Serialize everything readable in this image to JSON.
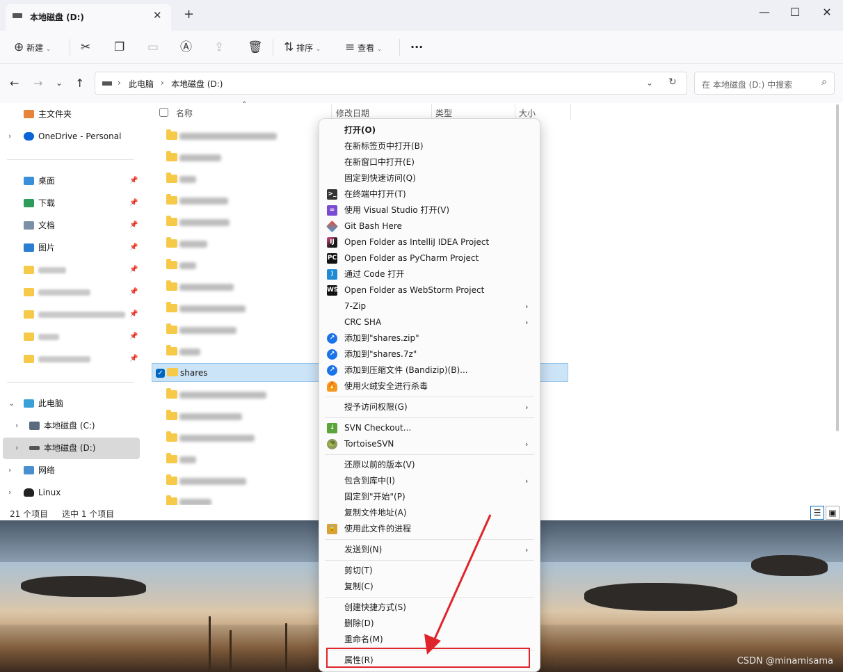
{
  "window": {
    "tab_title": "本地磁盘 (D:)",
    "minimize": "—",
    "maximize": "☐",
    "close": "✕",
    "new_tab": "+",
    "tab_close": "✕"
  },
  "toolbar": {
    "new_label": "新建",
    "sort_label": "排序",
    "view_label": "查看",
    "more": "···",
    "icons": {
      "cut": "cut-icon",
      "copy": "copy-icon",
      "paste": "paste-icon",
      "rename": "rename-icon",
      "share": "share-icon",
      "delete": "delete-icon"
    }
  },
  "nav": {
    "back": "←",
    "forward": "→",
    "recent": "⌄",
    "up": "↑",
    "breadcrumb": [
      "此电脑",
      "本地磁盘 (D:)"
    ],
    "search_placeholder": "在 本地磁盘 (D:) 中搜索"
  },
  "sidebar": {
    "home": "主文件夹",
    "onedrive": "OneDrive - Personal",
    "pinned": [
      {
        "label": "桌面",
        "icon": "desktop-icon"
      },
      {
        "label": "下载",
        "icon": "download-icon"
      },
      {
        "label": "文档",
        "icon": "document-icon"
      },
      {
        "label": "图片",
        "icon": "pictures-icon"
      }
    ],
    "this_pc": "此电脑",
    "drives": [
      "本地磁盘 (C:)",
      "本地磁盘 (D:)"
    ],
    "network": "网络",
    "linux": "Linux"
  },
  "list": {
    "headers": {
      "name": "名称",
      "modified": "修改日期",
      "type": "类型",
      "size": "大小"
    },
    "selected_item": "shares"
  },
  "status": {
    "count": "21 个项目",
    "selected": "选中 1 个项目"
  },
  "context_menu": {
    "items": [
      {
        "label": "打开(O)",
        "bold": true
      },
      {
        "label": "在新标签页中打开(B)"
      },
      {
        "label": "在新窗口中打开(E)"
      },
      {
        "label": "固定到快速访问(Q)"
      },
      {
        "label": "在终端中打开(T)",
        "icon": "terminal-icon"
      },
      {
        "label": "使用 Visual Studio 打开(V)",
        "icon": "visual-studio-icon"
      },
      {
        "label": "Git Bash Here",
        "icon": "git-icon"
      },
      {
        "label": "Open Folder as IntelliJ IDEA Project",
        "icon": "intellij-icon"
      },
      {
        "label": "Open Folder as PyCharm Project",
        "icon": "pycharm-icon"
      },
      {
        "label": "通过 Code 打开",
        "icon": "vscode-icon"
      },
      {
        "label": "Open Folder as WebStorm Project",
        "icon": "webstorm-icon"
      },
      {
        "label": "7-Zip",
        "submenu": true
      },
      {
        "label": "CRC SHA",
        "submenu": true
      },
      {
        "label": "添加到\"shares.zip\"",
        "icon": "bandizip-icon"
      },
      {
        "label": "添加到\"shares.7z\"",
        "icon": "bandizip-icon"
      },
      {
        "label": "添加到压缩文件 (Bandizip)(B)...",
        "icon": "bandizip-icon"
      },
      {
        "label": "使用火绒安全进行杀毒",
        "icon": "huorong-icon"
      },
      {
        "label": "授予访问权限(G)",
        "submenu": true
      },
      {
        "label": "SVN Checkout...",
        "icon": "svn-checkout-icon"
      },
      {
        "label": "TortoiseSVN",
        "icon": "tortoisesvn-icon",
        "submenu": true
      },
      {
        "label": "还原以前的版本(V)"
      },
      {
        "label": "包含到库中(I)",
        "submenu": true
      },
      {
        "label": "固定到\"开始\"(P)"
      },
      {
        "label": "复制文件地址(A)"
      },
      {
        "label": "使用此文件的进程",
        "icon": "lock-icon"
      },
      {
        "label": "发送到(N)",
        "submenu": true
      },
      {
        "label": "剪切(T)"
      },
      {
        "label": "复制(C)"
      },
      {
        "label": "创建快捷方式(S)"
      },
      {
        "label": "删除(D)"
      },
      {
        "label": "重命名(M)"
      },
      {
        "label": "属性(R)",
        "highlighted": true
      }
    ]
  },
  "annotation": {
    "color": "#e0242b"
  },
  "watermark": "CSDN @minamisama"
}
